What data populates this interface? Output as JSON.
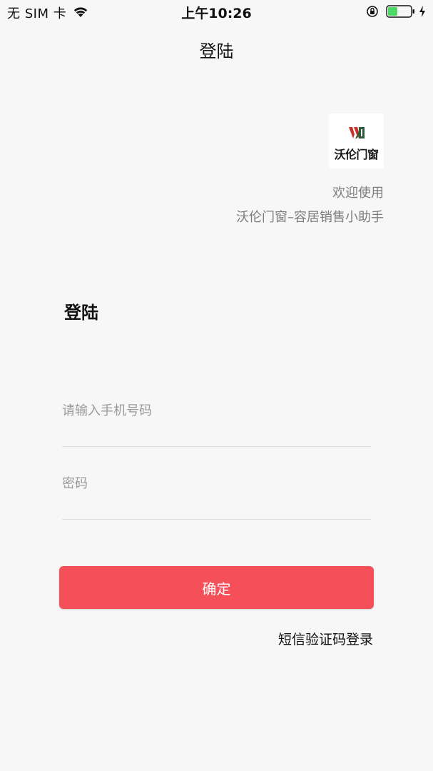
{
  "status_bar": {
    "carrier": "无 SIM 卡",
    "time": "上午10:26"
  },
  "nav": {
    "title": "登陆"
  },
  "brand": {
    "logo_text": "沃伦门窗",
    "welcome": "欢迎使用",
    "subtitle": "沃伦门窗–容居销售小助手"
  },
  "form": {
    "heading": "登陆",
    "phone_placeholder": "请输入手机号码",
    "password_placeholder": "密码",
    "confirm_label": "确定",
    "sms_login_label": "短信验证码登录"
  },
  "colors": {
    "accent": "#f5505a",
    "background": "#f7f7f7",
    "battery_fill": "#4cd964"
  }
}
